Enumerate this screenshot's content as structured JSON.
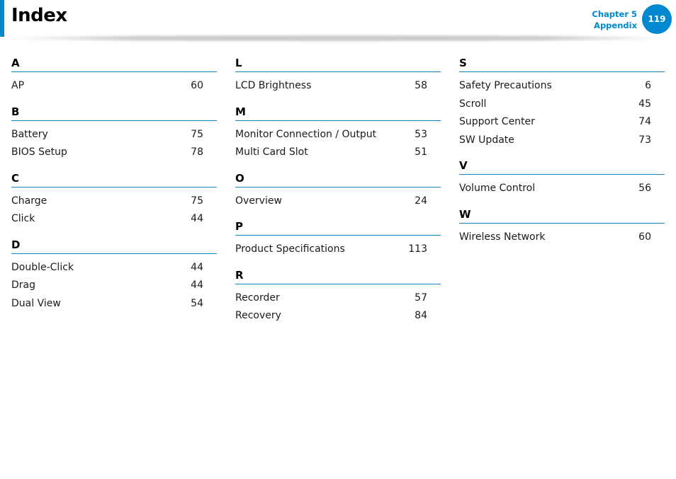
{
  "header": {
    "title": "Index",
    "chapter": "Chapter 5",
    "section": "Appendix",
    "page_number": "119",
    "accent_color": "#0088d1"
  },
  "columns": [
    {
      "sections": [
        {
          "letter": "A",
          "entries": [
            {
              "term": "AP",
              "page": "60"
            }
          ]
        },
        {
          "letter": "B",
          "entries": [
            {
              "term": "Battery",
              "page": "75"
            },
            {
              "term": "BIOS Setup",
              "page": "78"
            }
          ]
        },
        {
          "letter": "C",
          "entries": [
            {
              "term": "Charge",
              "page": "75"
            },
            {
              "term": "Click",
              "page": "44"
            }
          ]
        },
        {
          "letter": "D",
          "entries": [
            {
              "term": "Double-Click",
              "page": "44"
            },
            {
              "term": "Drag",
              "page": "44"
            },
            {
              "term": "Dual View",
              "page": "54"
            }
          ]
        }
      ]
    },
    {
      "sections": [
        {
          "letter": "L",
          "entries": [
            {
              "term": "LCD Brightness",
              "page": "58"
            }
          ]
        },
        {
          "letter": "M",
          "entries": [
            {
              "term": "Monitor Connection / Output",
              "page": "53"
            },
            {
              "term": "Multi Card Slot",
              "page": "51"
            }
          ]
        },
        {
          "letter": "O",
          "entries": [
            {
              "term": "Overview",
              "page": "24"
            }
          ]
        },
        {
          "letter": "P",
          "entries": [
            {
              "term": "Product Specifications",
              "page": "113"
            }
          ]
        },
        {
          "letter": "R",
          "entries": [
            {
              "term": "Recorder",
              "page": "57"
            },
            {
              "term": "Recovery",
              "page": "84"
            }
          ]
        }
      ]
    },
    {
      "sections": [
        {
          "letter": "S",
          "entries": [
            {
              "term": "Safety Precautions",
              "page": "6"
            },
            {
              "term": "Scroll",
              "page": "45"
            },
            {
              "term": "Support Center",
              "page": "74"
            },
            {
              "term": "SW Update",
              "page": "73"
            }
          ]
        },
        {
          "letter": "V",
          "entries": [
            {
              "term": "Volume Control",
              "page": "56"
            }
          ]
        },
        {
          "letter": "W",
          "entries": [
            {
              "term": "Wireless Network",
              "page": "60"
            }
          ]
        }
      ]
    }
  ]
}
